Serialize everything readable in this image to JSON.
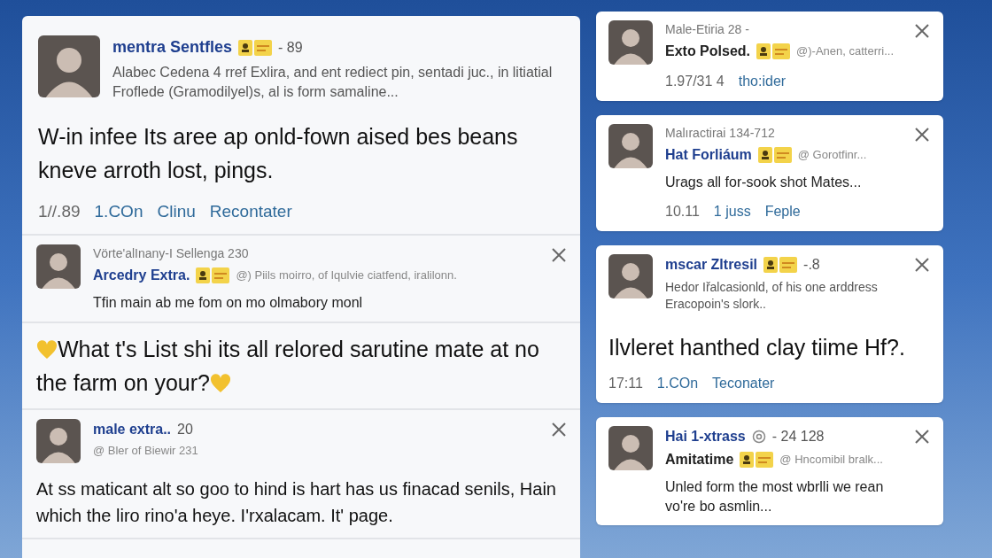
{
  "feed": [
    {
      "kind": "featured",
      "header": [
        [
          {
            "kind": "name",
            "text": "mentra Sentfles"
          },
          {
            "kind": "badges"
          },
          {
            "kind": "count",
            "text": "- 89"
          }
        ]
      ],
      "summary": "Alabec Cedena 4 rref Exlira, and ent rediect pin, sentadi juc., in litiatial Froflede (Gramodilyel)s, al is form samaline...",
      "body": "W-in infee Its aree ap onld-fown aised bes beans kneve arroth lost, pings.",
      "footer": [
        {
          "kind": "time",
          "text": "1//.89"
        },
        {
          "kind": "link",
          "text": "1.COn"
        },
        {
          "kind": "link",
          "text": "Clinu"
        },
        {
          "kind": "link",
          "text": "Recontater"
        }
      ],
      "close": false
    },
    {
      "kind": "reply",
      "header": [
        [
          {
            "kind": "overline",
            "text": "Vörte'alInany-I Sellenga 230"
          }
        ],
        [
          {
            "kind": "name",
            "text": "Arcedry Extra."
          },
          {
            "kind": "badges"
          },
          {
            "kind": "meta",
            "text": "@) Piils moirro, of Iqulvie ciatfend, iralilonn."
          }
        ]
      ],
      "text": "Tfin main ab me fom on mo olmabory monl",
      "close": true
    },
    {
      "kind": "quote",
      "body": "What t's List shi its all relored sarutine mate at no the farm on your?",
      "hearts": true,
      "close": false
    },
    {
      "kind": "reply",
      "header": [
        [
          {
            "kind": "name",
            "text": "male extra.."
          },
          {
            "kind": "count",
            "text": "20"
          }
        ],
        [
          {
            "kind": "meta",
            "text": "@ Bler of Biewir 231"
          }
        ]
      ],
      "body_small": "At ss maticant alt so goo to hind is hart has us finacad senils, Hain which the liro rino'a heye. I'rxalacam. It' page.",
      "close": true
    }
  ],
  "notifications": [
    {
      "header": [
        [
          {
            "kind": "overline",
            "text": "Male-Etiria 28 -"
          }
        ],
        [
          {
            "kind": "title",
            "text": "Exto Polsed."
          },
          {
            "kind": "badges"
          },
          {
            "kind": "meta",
            "text": "@)-Anen, catterri..."
          }
        ]
      ],
      "footer": [
        {
          "kind": "time",
          "text": "1.97/31 4"
        },
        {
          "kind": "link",
          "text": "tho:ider"
        }
      ],
      "close": true
    },
    {
      "header": [
        [
          {
            "kind": "overline",
            "text": "Malıractirai 134-712"
          }
        ],
        [
          {
            "kind": "name",
            "text": "Hat Forliáum"
          },
          {
            "kind": "badges"
          },
          {
            "kind": "meta",
            "text": "@ Gorotfinr..."
          }
        ]
      ],
      "text": "Urags all for-sook shot Mates...",
      "footer": [
        {
          "kind": "time",
          "text": "10.11"
        },
        {
          "kind": "link",
          "text": "1 juss"
        },
        {
          "kind": "link",
          "text": "Feple"
        }
      ],
      "close": true
    },
    {
      "header": [
        [
          {
            "kind": "name",
            "text": "mscar Zltresil"
          },
          {
            "kind": "badges"
          },
          {
            "kind": "count",
            "text": "-.8"
          }
        ]
      ],
      "summary": "Hedor Iřalcasionld, of his one arddress Eracopoin's slork..",
      "body": "Ilvleret hanthed clay tiime Hf?.",
      "footer": [
        {
          "kind": "time",
          "text": "17:11"
        },
        {
          "kind": "link",
          "text": "1.COn"
        },
        {
          "kind": "link",
          "text": "Teconater"
        }
      ],
      "close": true
    },
    {
      "header": [
        [
          {
            "kind": "name",
            "text": "Hai 1-xtrass"
          },
          {
            "kind": "at"
          },
          {
            "kind": "count",
            "text": "- 24 128"
          }
        ],
        [
          {
            "kind": "title",
            "text": "Amitatime"
          },
          {
            "kind": "badges"
          },
          {
            "kind": "meta",
            "text": "@ Hncomibil bralk..."
          }
        ]
      ],
      "text": "Unled form the most wbrlli we rean vo're bo asmlin...",
      "close": true
    }
  ]
}
